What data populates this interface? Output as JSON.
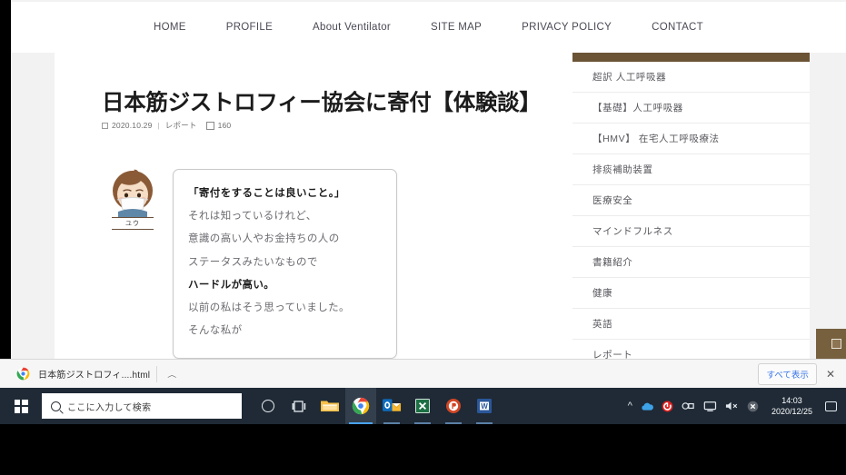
{
  "nav": {
    "items": [
      {
        "label": "HOME"
      },
      {
        "label": "PROFILE"
      },
      {
        "label": "About Ventilator"
      },
      {
        "label": "SITE MAP"
      },
      {
        "label": "PRIVACY POLICY"
      },
      {
        "label": "CONTACT"
      }
    ]
  },
  "post": {
    "title": "日本筋ジストロフィー協会に寄付【体験談】",
    "date": "2020.10.29",
    "separator": "|",
    "category": "レポート",
    "count": "160"
  },
  "avatar": {
    "name": "ユウ"
  },
  "bubble": {
    "lines": [
      {
        "text": "「寄付をすることは良いこと。」",
        "strong": true
      },
      {
        "text": "それは知っているけれど、",
        "strong": false
      },
      {
        "text": "意識の高い人やお金持ちの人の",
        "strong": false
      },
      {
        "text": "ステータスみたいなもので",
        "strong": false
      },
      {
        "text": "ハードルが高い。",
        "strong": true
      },
      {
        "text": "以前の私はそう思っていました。",
        "strong": false
      },
      {
        "text": "そんな私が",
        "strong": false
      }
    ]
  },
  "sidebar": {
    "items": [
      {
        "label": "超訳 人工呼吸器"
      },
      {
        "label": "【基礎】人工呼吸器"
      },
      {
        "label": "【HMV】 在宅人工呼吸療法"
      },
      {
        "label": "排痰補助装置"
      },
      {
        "label": "医療安全"
      },
      {
        "label": "マインドフルネス"
      },
      {
        "label": "書籍紹介"
      },
      {
        "label": "健康"
      },
      {
        "label": "英語"
      },
      {
        "label": "レポート"
      }
    ]
  },
  "download_bar": {
    "file_name": "日本筋ジストロフィ....html",
    "caret": "︿",
    "show_all_label": "すべて表示",
    "close_label": "✕"
  },
  "taskbar": {
    "search_placeholder": "ここに入力して検索",
    "clock_time": "14:03",
    "clock_date": "2020/12/25"
  },
  "colors": {
    "brand_brown": "#6b5335",
    "pagetop_brown": "#77603e",
    "taskbar": "#1f2a36",
    "link_blue": "#3a76e8"
  }
}
